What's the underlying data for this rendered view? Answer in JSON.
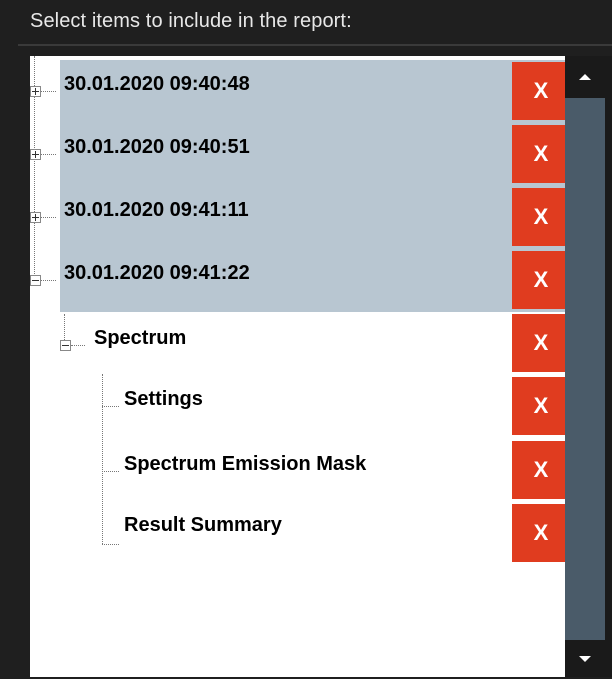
{
  "header": {
    "label": "Select items to include in the report:"
  },
  "tree": {
    "items": [
      {
        "label": "30.01.2020 09:40:48",
        "delete_label": "X"
      },
      {
        "label": "30.01.2020 09:40:51",
        "delete_label": "X"
      },
      {
        "label": "30.01.2020 09:41:11",
        "delete_label": "X"
      },
      {
        "label": "30.01.2020 09:41:22",
        "delete_label": "X"
      },
      {
        "label": "Spectrum",
        "delete_label": "X"
      },
      {
        "label": "Settings",
        "delete_label": "X"
      },
      {
        "label": "Spectrum Emission Mask",
        "delete_label": "X"
      },
      {
        "label": "Result Summary",
        "delete_label": "X"
      }
    ]
  },
  "colors": {
    "selected_row": "#b8c6d1",
    "delete_button": "#e03c1f",
    "scroll_thumb": "#4a5b69"
  },
  "icons": [
    "expand-plus-icon",
    "collapse-minus-icon",
    "scroll-up-arrow-icon",
    "scroll-down-arrow-icon"
  ]
}
